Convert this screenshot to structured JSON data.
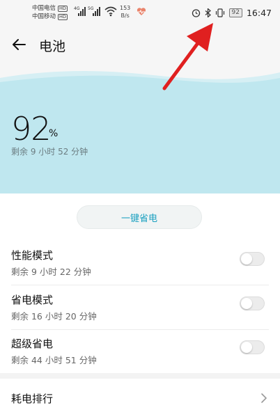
{
  "status_bar": {
    "carrier1": "中国电信",
    "carrier2": "中国移动",
    "hd": "HD",
    "net1": "4G",
    "net2": "5G",
    "speed_value": "153",
    "speed_unit": "B/s",
    "battery": "92",
    "time": "16:47"
  },
  "header": {
    "title": "电池"
  },
  "battery": {
    "percent": "92",
    "percent_sign": "%",
    "remaining": "剩余 9 小时 52 分钟"
  },
  "one_key_button": "一键省电",
  "modes": [
    {
      "title": "性能模式",
      "subtitle": "剩余 9 小时 22 分钟",
      "enabled": false
    },
    {
      "title": "省电模式",
      "subtitle": "剩余 16 小时 20 分钟",
      "enabled": false
    },
    {
      "title": "超级省电",
      "subtitle": "剩余 44 小时 51 分钟",
      "enabled": false
    }
  ],
  "ranking": {
    "label": "耗电排行"
  },
  "colors": {
    "hero": "#bfe7ef",
    "accent": "#1aa0c0",
    "annotation_arrow": "#e02020"
  }
}
